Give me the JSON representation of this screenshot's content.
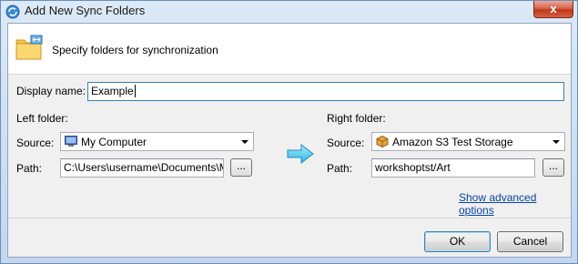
{
  "window": {
    "title": "Add New Sync Folders",
    "close_label": "x"
  },
  "header": {
    "text": "Specify folders for synchronization"
  },
  "display_name": {
    "label": "Display name:",
    "value": "Example"
  },
  "left": {
    "section_label": "Left folder:",
    "source_label": "Source:",
    "source_value": "My Computer",
    "path_label": "Path:",
    "path_value": "C:\\Users\\username\\Documents\\My",
    "browse_label": "..."
  },
  "right": {
    "section_label": "Right folder:",
    "source_label": "Source:",
    "source_value": "Amazon S3 Test Storage",
    "path_label": "Path:",
    "path_value": "workshoptst/Art",
    "browse_label": "..."
  },
  "advanced_link": "Show advanced options",
  "buttons": {
    "ok": "OK",
    "cancel": "Cancel"
  },
  "colors": {
    "accent": "#3c7fb1",
    "link": "#0645ad",
    "close": "#c0371a"
  }
}
